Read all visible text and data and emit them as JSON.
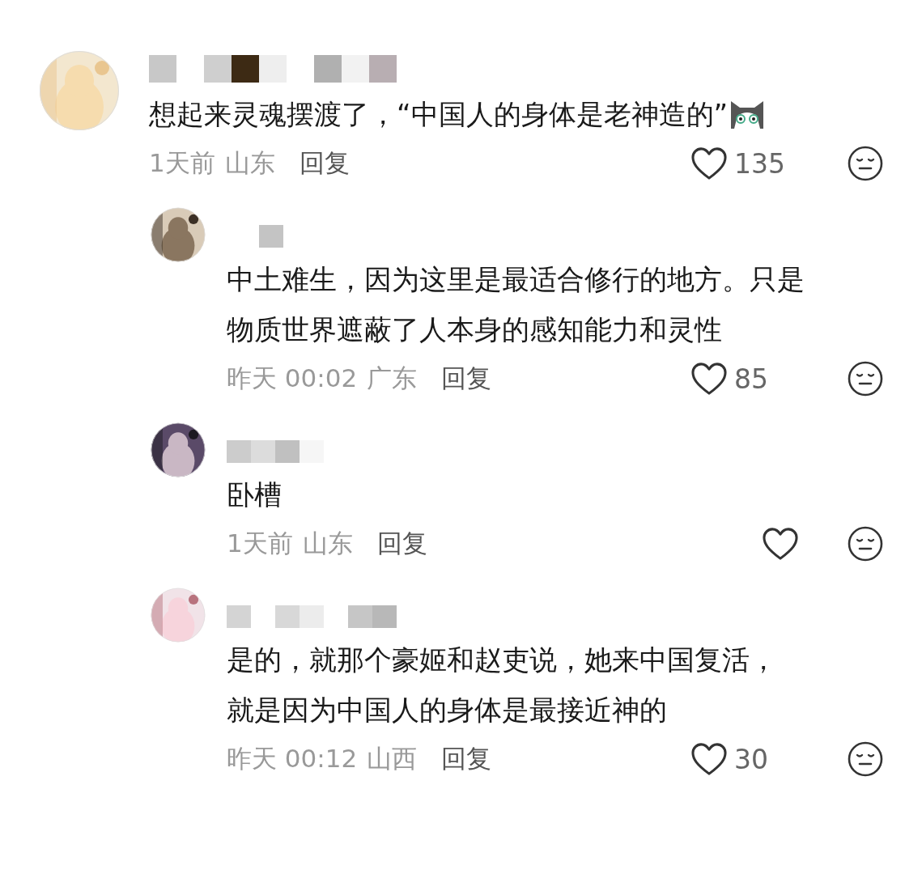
{
  "comments": [
    {
      "kind": "top",
      "text": "想起来灵魂摆渡了，“中国人的身体是老神造的”",
      "sticker": true,
      "time": "1天前",
      "location": "山东",
      "reply_label": "回复",
      "likes": "135",
      "liked": false
    },
    {
      "kind": "reply",
      "text": "中土难生，因为这里是最适合修行的地方。只是物质世界遮蔽了人本身的感知能力和灵性",
      "sticker": false,
      "time": "昨天 00:02",
      "location": "广东",
      "reply_label": "回复",
      "likes": "85",
      "liked": false
    },
    {
      "kind": "reply",
      "text": "卧槽",
      "sticker": false,
      "time": "1天前",
      "location": "山东",
      "reply_label": "回复",
      "liked": false
    },
    {
      "kind": "reply",
      "text": "是的，就那个豪姬和赵吏说，她来中国复活，就是因为中国人的身体是最接近神的",
      "sticker": false,
      "time": "昨天 00:12",
      "location": "山西",
      "reply_label": "回复",
      "likes": "30",
      "liked": false
    }
  ]
}
